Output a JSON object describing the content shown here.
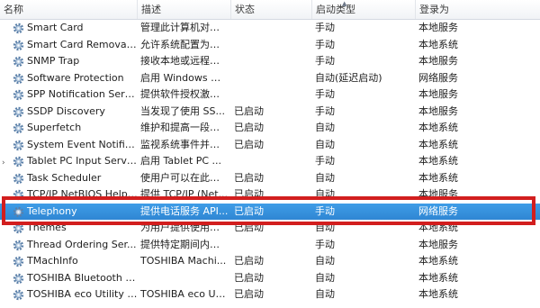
{
  "columns": {
    "name": "名称",
    "description": "描述",
    "status": "状态",
    "startup_type": "启动类型",
    "logon_as": "登录为"
  },
  "services": [
    {
      "name": "Smart Card",
      "description": "管理此计算机对智...",
      "status": "",
      "startup_type": "手动",
      "logon_as": "本地服务"
    },
    {
      "name": "Smart Card Removal ...",
      "description": "允许系统配置为移...",
      "status": "",
      "startup_type": "手动",
      "logon_as": "本地系统"
    },
    {
      "name": "SNMP Trap",
      "description": "接收本地或远程简...",
      "status": "",
      "startup_type": "手动",
      "logon_as": "本地服务"
    },
    {
      "name": "Software Protection",
      "description": "启用 Windows 和...",
      "status": "",
      "startup_type": "自动(延迟启动)",
      "logon_as": "网络服务"
    },
    {
      "name": "SPP Notification Servi...",
      "description": "提供软件授权激活...",
      "status": "",
      "startup_type": "手动",
      "logon_as": "本地服务"
    },
    {
      "name": "SSDP Discovery",
      "description": "当发现了使用 SS...",
      "status": "已启动",
      "startup_type": "手动",
      "logon_as": "本地服务"
    },
    {
      "name": "Superfetch",
      "description": "维护和提高一段时...",
      "status": "已启动",
      "startup_type": "自动",
      "logon_as": "本地系统"
    },
    {
      "name": "System Event Notifica...",
      "description": "监视系统事件并通...",
      "status": "已启动",
      "startup_type": "自动",
      "logon_as": "本地系统"
    },
    {
      "name": "Tablet PC Input Service",
      "description": "启用 Tablet PC ...",
      "status": "",
      "startup_type": "手动",
      "logon_as": "本地系统"
    },
    {
      "name": "Task Scheduler",
      "description": "使用户可以在此计...",
      "status": "已启动",
      "startup_type": "自动",
      "logon_as": "本地系统"
    },
    {
      "name": "TCP/IP NetBIOS Helper",
      "description": "提供 TCP/IP (Net...",
      "status": "已启动",
      "startup_type": "自动",
      "logon_as": "本地服务"
    },
    {
      "name": "Telephony",
      "description": "提供电话服务 API...",
      "status": "已启动",
      "startup_type": "手动",
      "logon_as": "网络服务",
      "selected": true
    },
    {
      "name": "Themes",
      "description": "为用户提供使用主...",
      "status": "已启动",
      "startup_type": "自动",
      "logon_as": "本地系统"
    },
    {
      "name": "Thread Ordering Ser...",
      "description": "提供特定期间内一...",
      "status": "",
      "startup_type": "手动",
      "logon_as": "本地服务"
    },
    {
      "name": "TMachInfo",
      "description": "TOSHIBA Machi...",
      "status": "已启动",
      "startup_type": "自动",
      "logon_as": "本地系统"
    },
    {
      "name": "TOSHIBA Bluetooth S...",
      "description": "",
      "status": "已启动",
      "startup_type": "自动",
      "logon_as": "本地系统"
    },
    {
      "name": "TOSHIBA eco Utility S...",
      "description": "TOSHIBA eco Ut...",
      "status": "已启动",
      "startup_type": "自动",
      "logon_as": "本地系统"
    }
  ],
  "colors": {
    "selection": "#3592de",
    "highlight_frame": "#d21e1e"
  },
  "icons": {
    "service": "gear-icon",
    "sort": "sort-ascending-icon"
  }
}
